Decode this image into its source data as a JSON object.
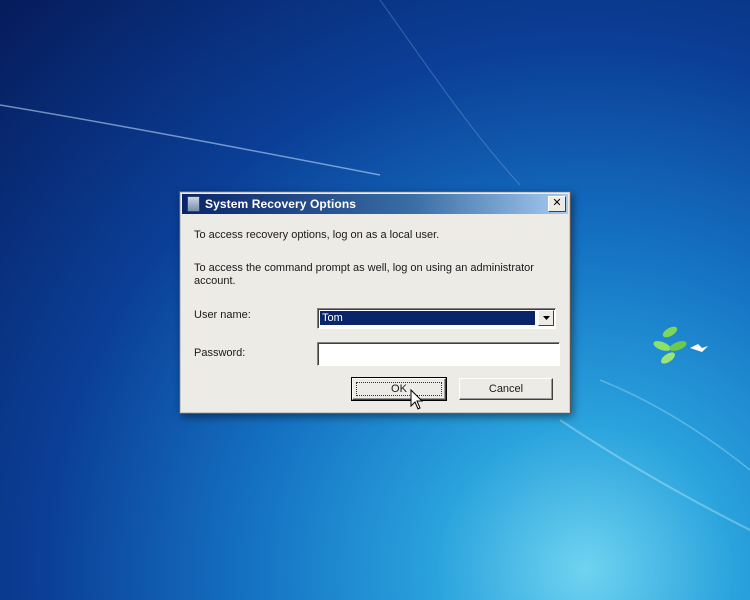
{
  "dialog": {
    "title": "System Recovery Options",
    "close_symbol": "✕",
    "line1": "To access recovery options, log on as a local user.",
    "line2": "To access the command prompt as well, log on using an administrator account.",
    "user_name_label": "User name:",
    "user_name_value": "Tom",
    "password_label": "Password:",
    "password_value": "",
    "ok_label": "OK",
    "cancel_label": "Cancel"
  },
  "icons": {
    "title": "system-recovery-icon",
    "dropdown": "chevron-down-icon",
    "cursor": "mouse-pointer-icon",
    "desktop_logo": "windows-flag-logo"
  },
  "colors": {
    "title_bar": "#0a246a",
    "selection": "#0a246a",
    "dialog_face": "#ecebe6"
  }
}
